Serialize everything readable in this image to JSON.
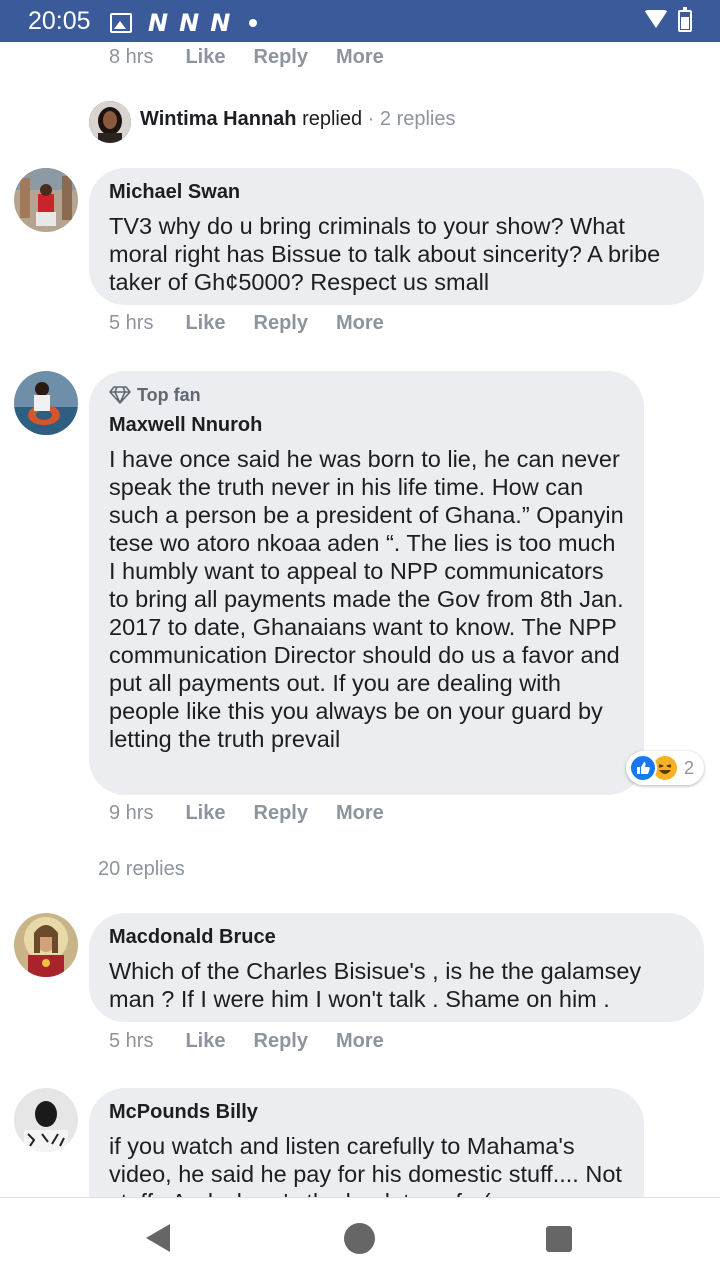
{
  "status_bar": {
    "time": "20:05",
    "notif_letters": [
      "N",
      "N",
      "N"
    ]
  },
  "thread": {
    "prev_meta": {
      "time": "8 hrs",
      "like": "Like",
      "reply": "Reply",
      "more": "More"
    },
    "replied": {
      "name": "Wintima Hannah",
      "verb": "replied",
      "sep": " · ",
      "count": "2 replies"
    },
    "comments": [
      {
        "name": "Michael Swan",
        "badge": "",
        "text": "TV3 why do u bring criminals to your show? What moral right has Bissue to talk about sincerity? A bribe taker of Gh¢5000? Respect us small",
        "time": "5 hrs",
        "like": "Like",
        "reply": "Reply",
        "more": "More"
      },
      {
        "name": "Maxwell Nnuroh",
        "badge": "Top fan",
        "text": "I have once said he was born to lie, he can never speak the truth never in his life time. How can such a person be a president of Ghana.” Opanyin tese wo atoro nkoaa aden “. The lies is too much I humbly want to appeal to NPP communicators to bring all payments made the Gov from 8th Jan. 2017 to date, Ghanaians want to know. The NPP communication Director should do us a favor and put all payments out. If you are dealing with people like this you always be on your guard by letting the truth prevail",
        "reactions": {
          "icons": [
            "like-icon",
            "haha-icon"
          ],
          "count": "2"
        },
        "time": "9 hrs",
        "like": "Like",
        "reply": "Reply",
        "more": "More"
      },
      {
        "name": "Macdonald Bruce",
        "badge": "",
        "text": "Which of the Charles Bisisue's , is he the galamsey man ? If I were him I won't talk . Shame on him .",
        "time": "5 hrs",
        "like": "Like",
        "reply": "Reply",
        "more": "More"
      },
      {
        "name": "McPounds Billy",
        "badge": "",
        "text": "if you watch and listen carefully to Mahama's video, he said he pay for his domestic stuff.... Not staff.. And where's the bank transfer(",
        "time": "",
        "like": "",
        "reply": "",
        "more": ""
      }
    ],
    "more_replies": "20 replies"
  },
  "colors": {
    "statusbar": "#3b5a9a",
    "bubble": "#ebedf0",
    "meta": "#8d949e",
    "like_blue": "#1877f2",
    "haha_yellow": "#f7b125"
  },
  "nav": {
    "icons": [
      "back-icon",
      "home-icon",
      "recents-icon"
    ]
  }
}
